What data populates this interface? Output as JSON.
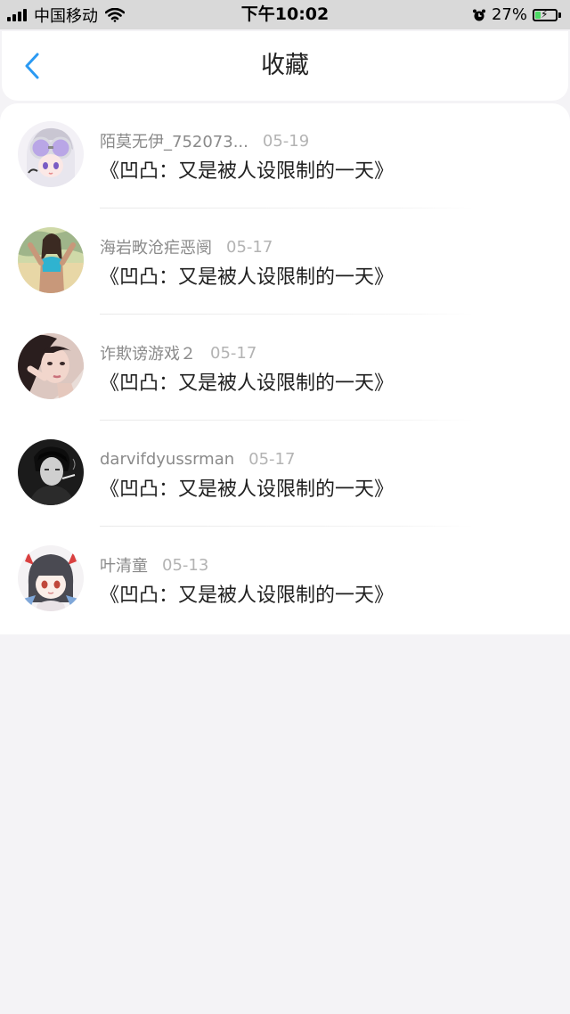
{
  "status_bar": {
    "carrier": "中国移动",
    "time": "下午10:02",
    "battery": "27%",
    "battery_level": 0.27,
    "icons": [
      "signal-icon",
      "wifi-icon",
      "alarm-icon",
      "battery-icon"
    ]
  },
  "nav": {
    "title": "收藏",
    "back_icon": "chevron-left-icon",
    "accent": "#2b9af3"
  },
  "items": [
    {
      "username": "陌莫无伊_752073...",
      "date": "05-19",
      "book": "《凹凸：又是被人设限制的一天》",
      "avatar": "avatar-anime-purple-glasses"
    },
    {
      "username": "海岩畋沧疟恶阌",
      "date": "05-17",
      "book": "《凹凸：又是被人设限制的一天》",
      "avatar": "avatar-woman-blue-top"
    },
    {
      "username": "诈欺谤游戏２",
      "date": "05-17",
      "book": "《凹凸：又是被人设限制的一天》",
      "avatar": "avatar-woman-portrait"
    },
    {
      "username": "darvifdyussrman",
      "date": "05-17",
      "book": "《凹凸：又是被人设限制的一天》",
      "avatar": "avatar-man-monochrome"
    },
    {
      "username": "叶清童",
      "date": "05-13",
      "book": "《凹凸：又是被人设限制的一天》",
      "avatar": "avatar-anime-red-horns"
    }
  ]
}
